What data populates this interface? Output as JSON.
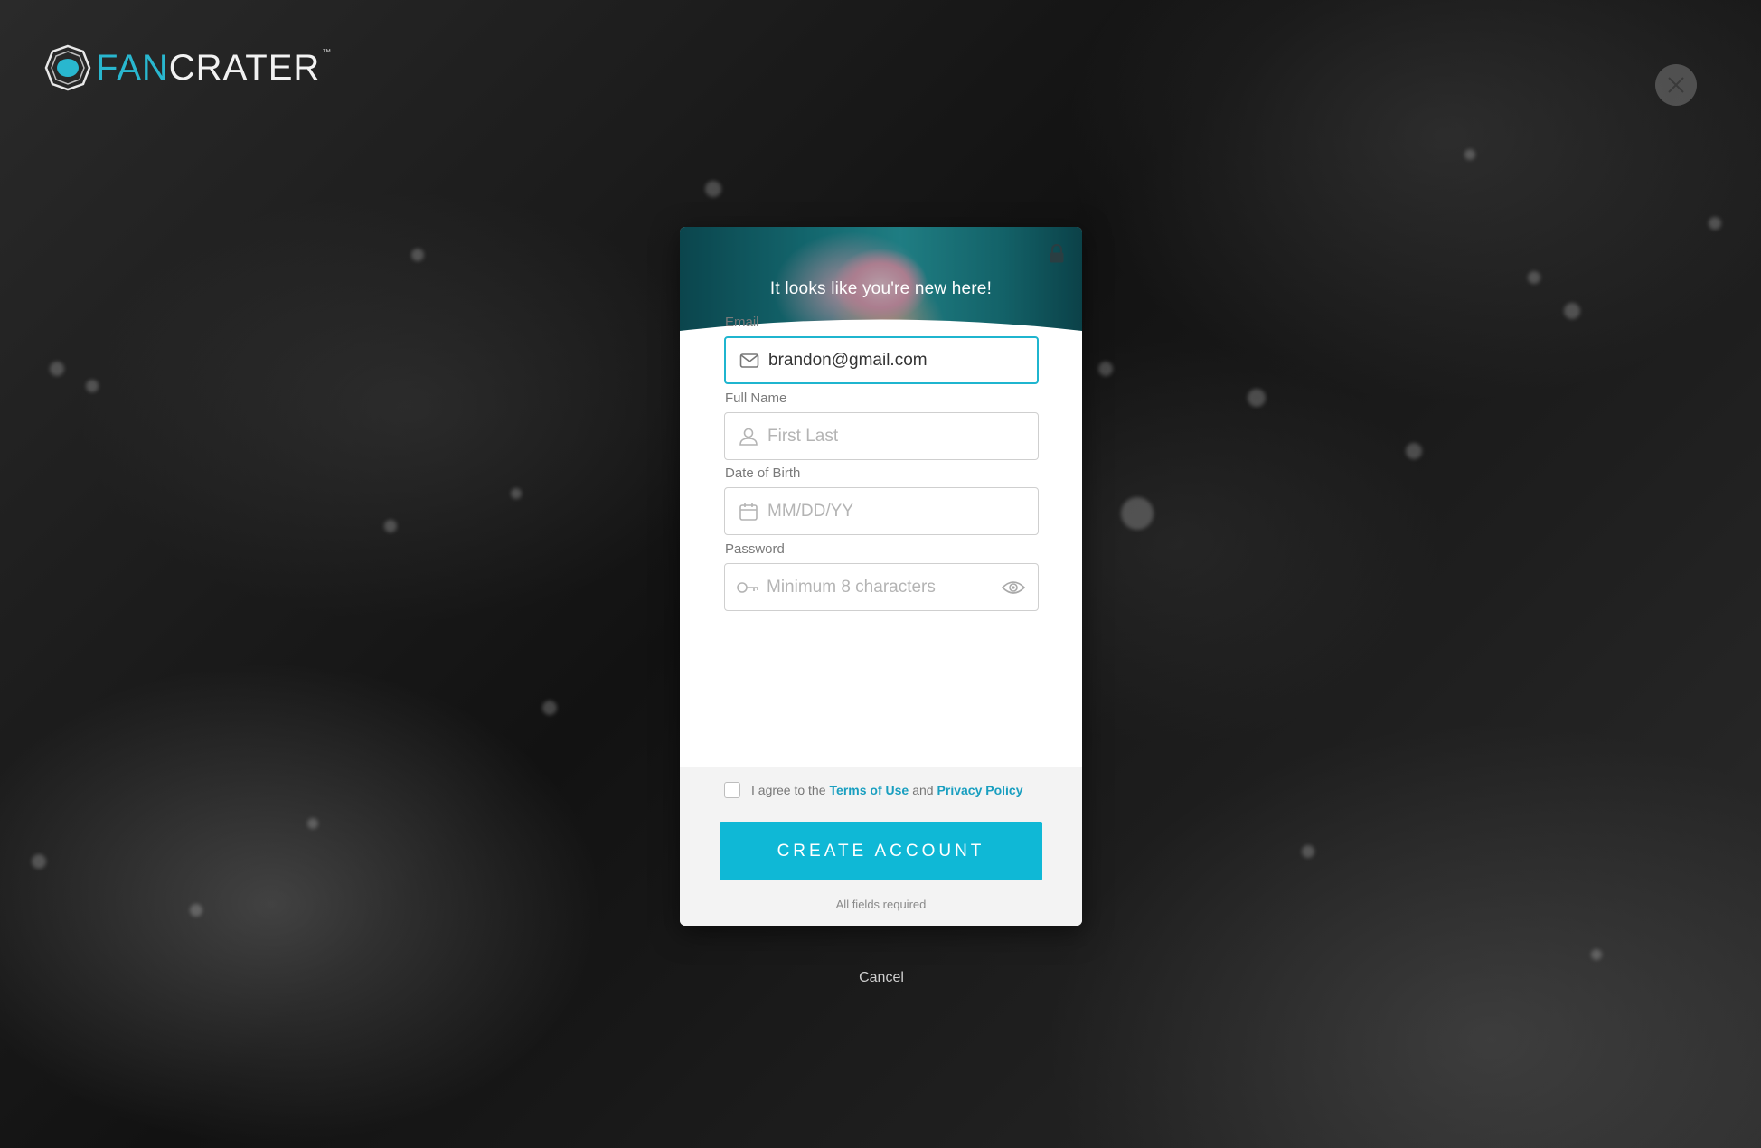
{
  "brand": {
    "name_part1": "FAN",
    "name_part2": "CRATER",
    "trademark": "™",
    "accent_color": "#29b7cf"
  },
  "icons": {
    "logo": "fancrater-logo-icon",
    "close": "close-icon",
    "lock": "lock-icon",
    "email": "envelope-icon",
    "name": "user-icon",
    "dob": "calendar-icon",
    "password": "key-icon",
    "reveal": "eye-icon"
  },
  "signup": {
    "heading": "It looks like you're new here!",
    "email": {
      "label": "Email",
      "value": "brandon@gmail.com"
    },
    "full_name": {
      "label": "Full Name",
      "placeholder": "First Last"
    },
    "dob": {
      "label": "Date of Birth",
      "placeholder": "MM/DD/YY"
    },
    "password": {
      "label": "Password",
      "placeholder": "Minimum 8 characters"
    },
    "agree": {
      "prefix": "I agree to the",
      "terms_link": "Terms of Use",
      "conjunction": "and",
      "privacy_link": "Privacy Policy"
    },
    "submit_label": "CREATE ACCOUNT",
    "required_note": "All fields required",
    "button_color": "#0fb8d6"
  },
  "cancel_label": "Cancel"
}
